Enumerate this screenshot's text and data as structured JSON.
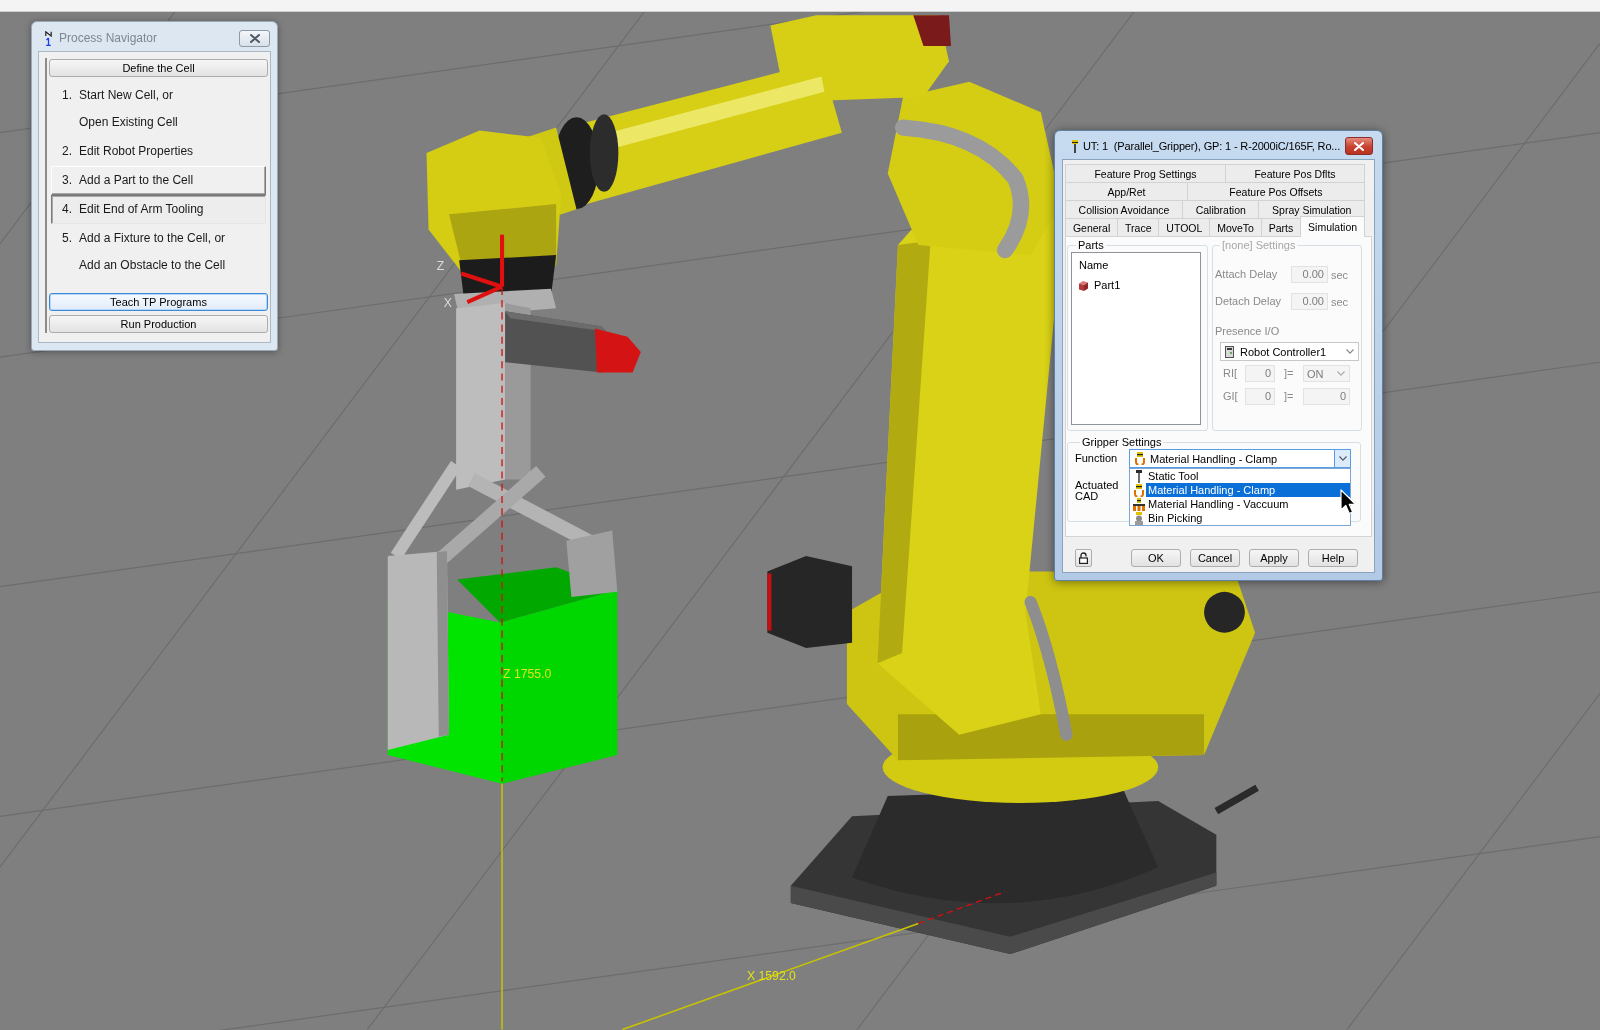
{
  "viewport": {
    "axis_letters": [
      "Z",
      "X"
    ],
    "dimension_labels": [
      "Z 1755.0",
      "X 1592.0"
    ]
  },
  "navigator": {
    "title": "Process Navigator",
    "active": false,
    "header_button": {
      "label": "Define the Cell",
      "focused": false
    },
    "steps": [
      {
        "number": "1.",
        "lines": [
          "Start New Cell, or",
          "Open Existing Cell"
        ],
        "selected": false,
        "hovered": false
      },
      {
        "number": "2.",
        "lines": [
          "Edit Robot Properties"
        ],
        "selected": false,
        "hovered": false
      },
      {
        "number": "3.",
        "lines": [
          "Add a Part to the Cell"
        ],
        "selected": false,
        "hovered": true
      },
      {
        "number": "4.",
        "lines": [
          "Edit End of Arm Tooling"
        ],
        "selected": true,
        "hovered": false
      },
      {
        "number": "5.",
        "lines": [
          "Add a Fixture to the Cell, or",
          "Add an Obstacle to the Cell"
        ],
        "selected": false,
        "hovered": false
      }
    ],
    "footer_buttons": [
      {
        "label": "Teach TP Programs",
        "focused": true
      },
      {
        "label": "Run Production",
        "focused": false
      }
    ]
  },
  "dialog": {
    "title": "UT: 1  (Parallel_Gripper), GP: 1 - R-2000iC/165F, Ro...",
    "active": true,
    "tab_rows": [
      [
        {
          "label": "Feature Prog Settings",
          "selected": false
        },
        {
          "label": "Feature Pos Dflts",
          "selected": false
        }
      ],
      [
        {
          "label": "App/Ret",
          "selected": false
        },
        {
          "label": "Feature Pos Offsets",
          "selected": false
        }
      ],
      [
        {
          "label": "Collision Avoidance",
          "selected": false
        },
        {
          "label": "Calibration",
          "selected": false
        },
        {
          "label": "Spray Simulation",
          "selected": false
        }
      ],
      [
        {
          "label": "General",
          "selected": false
        },
        {
          "label": "Trace",
          "selected": false
        },
        {
          "label": "UTOOL",
          "selected": false
        },
        {
          "label": "MoveTo",
          "selected": false
        },
        {
          "label": "Parts",
          "selected": false
        },
        {
          "label": "Simulation",
          "selected": true
        }
      ]
    ],
    "parts": {
      "title": "Parts",
      "header": "Name",
      "items": [
        {
          "label": "Part1"
        }
      ]
    },
    "part_settings": {
      "title": "[none] Settings",
      "disabled": true,
      "delays": [
        {
          "label": "Attach Delay",
          "value": "0.00",
          "unit": "sec"
        },
        {
          "label": "Detach Delay",
          "value": "0.00",
          "unit": "sec"
        }
      ],
      "presence_label": "Presence I/O",
      "controller": "Robot Controller1",
      "signals": [
        {
          "prefix": "RI[",
          "index": "0",
          "suffix": "]=",
          "value": "ON",
          "kind": "select"
        },
        {
          "prefix": "GI[",
          "index": "0",
          "suffix": "]=",
          "value": "0",
          "kind": "field"
        }
      ]
    },
    "gripper_settings": {
      "title": "Gripper Settings",
      "function_label": "Function",
      "function_value": "Material Handling - Clamp",
      "expanded": true,
      "options": [
        {
          "label": "Static Tool",
          "kind": "static",
          "selected": false
        },
        {
          "label": "Material Handling - Clamp",
          "kind": "clamp",
          "selected": true
        },
        {
          "label": "Material Handling - Vaccuum",
          "kind": "vacuum",
          "selected": false
        },
        {
          "label": "Bin Picking",
          "kind": "bin",
          "selected": false
        }
      ],
      "actuated_label": "Actuated CAD"
    },
    "buttons": [
      {
        "label": "OK"
      },
      {
        "label": "Cancel"
      },
      {
        "label": "Apply"
      },
      {
        "label": "Help"
      }
    ]
  }
}
